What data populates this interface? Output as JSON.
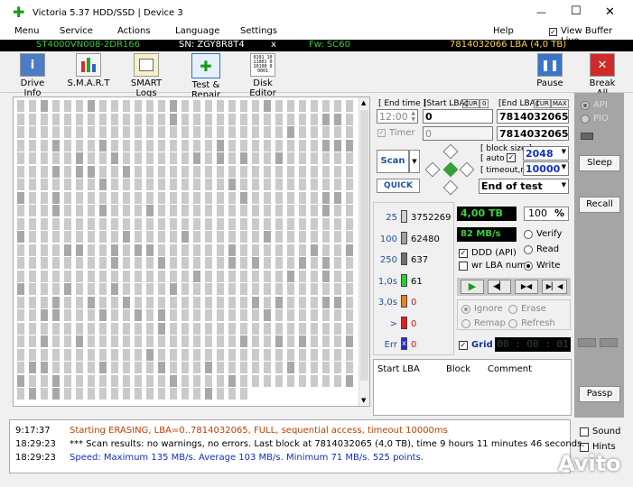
{
  "window": {
    "title": "Victoria 5.37 HDD/SSD | Device 3",
    "minimize": "—",
    "maximize": "☐",
    "close": "✕"
  },
  "menu": {
    "items": [
      "Menu",
      "Service",
      "Actions",
      "Language",
      "Settings",
      "Help"
    ],
    "view_buffer_live": "View Buffer Live"
  },
  "info": {
    "model": "ST4000VN008-2DR166",
    "serial": "SN: ZGY8R8T4",
    "close": "x",
    "firmware": "Fw: SC60",
    "lba": "7814032066 LBA (4,0 TB)"
  },
  "toolbar": {
    "drive_info": "Drive Info",
    "smart": "S.M.A.R.T",
    "smart_logs": "SMART Logs",
    "test_repair": "Test & Repair",
    "disk_editor": "Disk Editor",
    "disk_editor_icon_text": "0101 10\n11001 0\n10100 0\n0001",
    "pause": "Pause",
    "break_all": "Break All"
  },
  "scan_settings": {
    "end_time_label": "[ End time ]",
    "end_time_value": "12:00",
    "start_lba_label": "[Start LBA]",
    "cur1": "CUR",
    "zero": "0",
    "start_lba_value": "0",
    "end_lba_label": "[End LBA]",
    "cur2": "CUR",
    "max": "MAX",
    "end_lba_value": "7814032065",
    "timer_label": "Timer",
    "timer_value": "0",
    "end_lba_value2": "7814032065",
    "scan_button": "Scan",
    "quick_button": "QUICK",
    "block_size_label": "[ block size ]",
    "block_size_value": "2048",
    "auto_label": "[ auto ]",
    "timeout_label": "[ timeout,ms ]",
    "timeout_value": "10000",
    "end_action": "End of test"
  },
  "stats": {
    "rows": [
      {
        "label": "25",
        "count": "3752269",
        "color": "#d0d0d0"
      },
      {
        "label": "100",
        "count": "62480",
        "color": "#a0a0a0"
      },
      {
        "label": "250",
        "count": "637",
        "color": "#707070"
      },
      {
        "label": "1,0s",
        "count": "61",
        "color": "#2ecc2e"
      },
      {
        "label": "3,0s",
        "count": "0",
        "color": "#f08020"
      },
      {
        "label": ">",
        "count": "0",
        "color": "#e02020"
      },
      {
        "label": "Err",
        "count": "0",
        "color": "#2030d0"
      }
    ],
    "err_mark": "x"
  },
  "progress": {
    "size": "4,00 TB",
    "percent": "100",
    "percent_unit": "%",
    "speed": "82 MB/s",
    "verify": "Verify",
    "read": "Read",
    "write": "Write",
    "ddd": "DDD (API)",
    "wr_lba": "wr LBA num"
  },
  "repair": {
    "ignore": "Ignore",
    "erase": "Erase",
    "remap": "Remap",
    "refresh": "Refresh",
    "grid": "Grid",
    "time": "00 : 00 : 01"
  },
  "defects_table": {
    "columns": [
      "Start LBA",
      "Block",
      "Comment"
    ]
  },
  "right": {
    "api": "API",
    "pio": "PIO",
    "sleep": "Sleep",
    "recall": "Recall",
    "passp": "Passp",
    "sound": "Sound",
    "hints": "Hints"
  },
  "log": [
    {
      "time": "9:17:37",
      "text": "Starting ERASING, LBA=0..7814032065, FULL, sequential access, timeout 10000ms",
      "color": "#c04000"
    },
    {
      "time": "18:29:23",
      "text": "*** Scan results: no warnings, no errors. Last block at 7814032065 (4,0 TB), time 9 hours 11 minutes 46 seconds.",
      "color": "#000000"
    },
    {
      "time": "18:29:23",
      "text": "Speed: Maximum 135 MB/s. Average 103 MB/s. Minimum 71 MB/s. 525 points.",
      "color": "#1030c0"
    }
  ],
  "watermark": "Avito"
}
